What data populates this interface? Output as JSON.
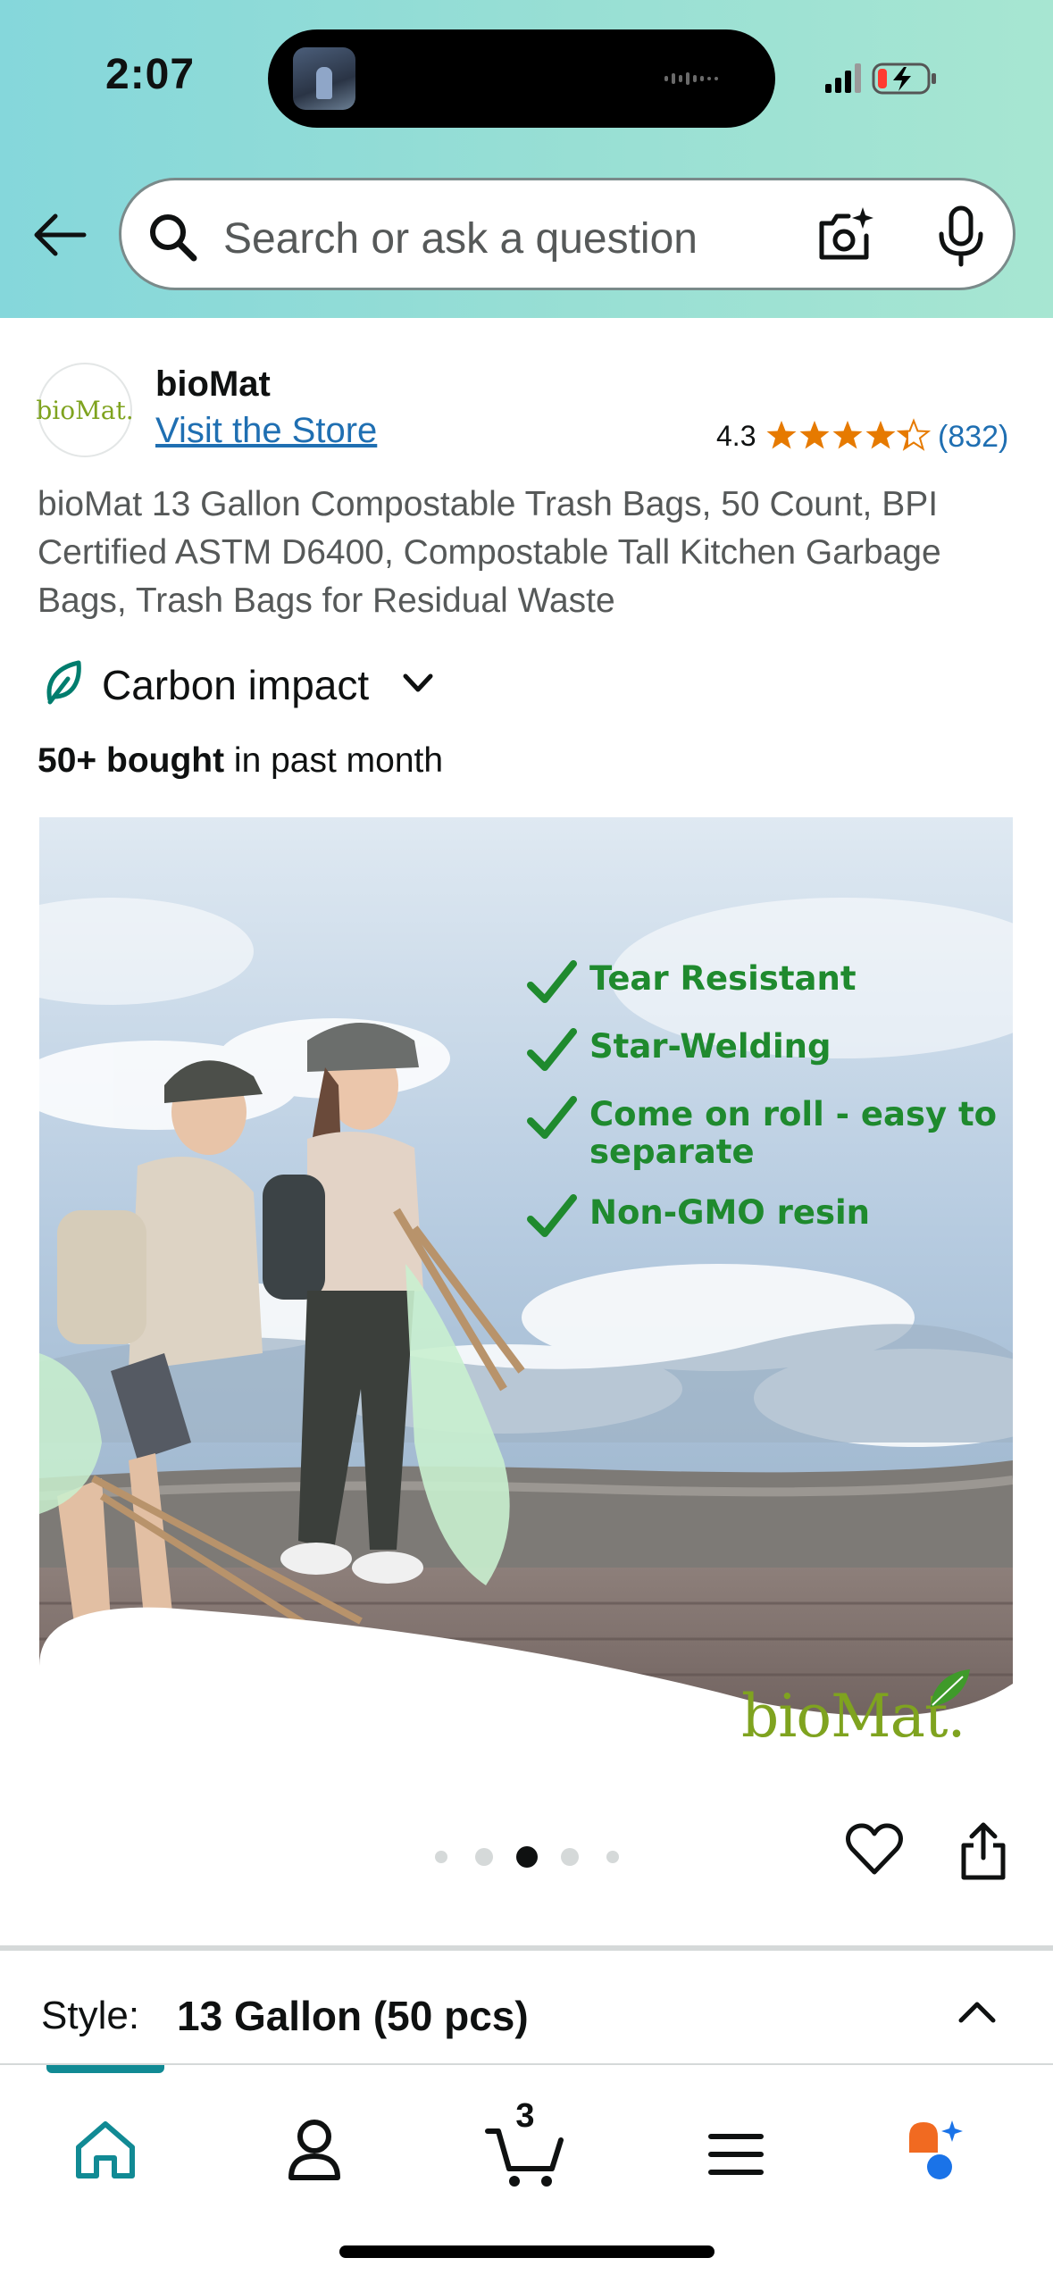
{
  "status_bar": {
    "time": "2:07"
  },
  "search": {
    "placeholder": "Search or ask a question"
  },
  "brand": {
    "name": "bioMat",
    "logo_text": "bioMat.",
    "visit_store": "Visit the Store"
  },
  "rating": {
    "value": "4.3",
    "stars": 4.3,
    "count": "(832)"
  },
  "product": {
    "title": "bioMat 13 Gallon Compostable Trash Bags, 50 Count, BPI Certified ASTM D6400, Compostable Tall Kitchen Garbage Bags, Trash Bags for Residual Waste",
    "carbon_impact": "Carbon impact",
    "bought_bold": "50+ bought",
    "bought_rest": " in past month"
  },
  "image": {
    "features": [
      "Tear Resistant",
      "Star-Welding",
      "Come on roll - easy to separate",
      "Non-GMO resin"
    ],
    "logo_text": "bioMat."
  },
  "carousel": {
    "total": 5,
    "active": 3
  },
  "style": {
    "label": "Style:",
    "value": "13 Gallon (50 pcs)"
  },
  "bottom_nav": {
    "items": [
      "home",
      "account",
      "cart",
      "menu",
      "rufus"
    ],
    "cart_count": "3",
    "active": "home"
  },
  "colors": {
    "link": "#1f6fb2",
    "star": "#e67a00",
    "feature_green": "#1f8a2e",
    "nav_active": "#118a94",
    "rufus_orange": "#f16a21",
    "rufus_blue": "#1a73e8"
  }
}
